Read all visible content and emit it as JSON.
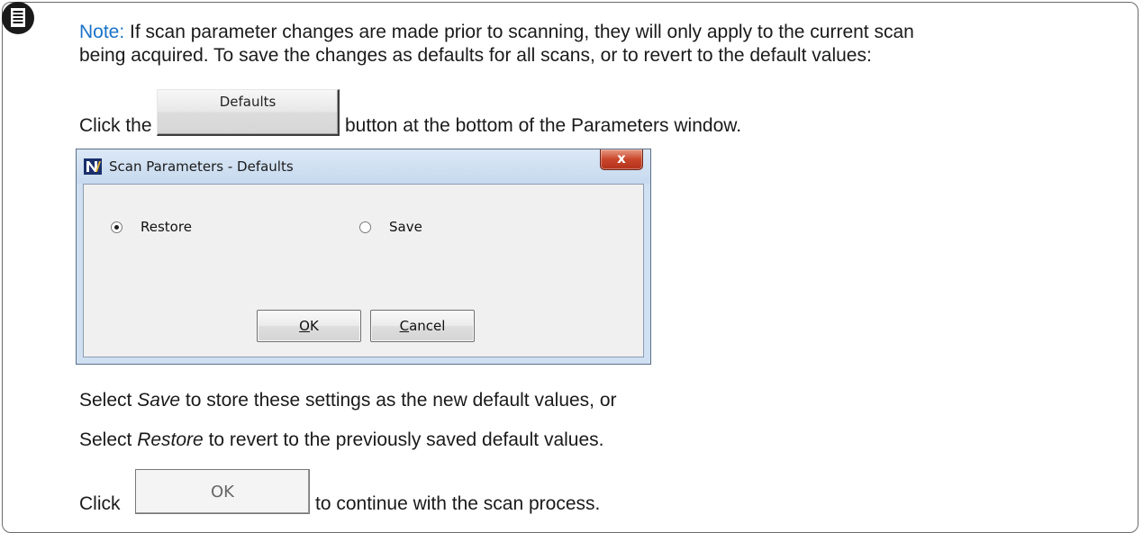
{
  "note": {
    "icon": "note-icon",
    "label": "Note:",
    "line1": "If scan parameter changes are made prior to scanning, they will only apply to the current scan",
    "line2": "being acquired. To save the changes as defaults for all scans, or to revert to the default values:"
  },
  "step1": {
    "before": "Click the",
    "button_label": "Defaults",
    "after": "button at the bottom of the Parameters window."
  },
  "dialog": {
    "title": "Scan Parameters - Defaults",
    "close_label": "x",
    "options": [
      {
        "label": "Restore",
        "selected": true
      },
      {
        "label": "Save",
        "selected": false
      }
    ],
    "ok_hotkey": "O",
    "ok_rest": "K",
    "cancel_hotkey": "C",
    "cancel_rest": "ancel"
  },
  "step2": {
    "line1_before": "Select ",
    "line1_em": "Save",
    "line1_after": " to store these settings as the new default values, or",
    "line2_before": "Select ",
    "line2_em": "Restore",
    "line2_after": " to revert to the previously saved default values."
  },
  "step3": {
    "before": "Click",
    "button_label": "OK",
    "after": "to continue with the scan process."
  }
}
